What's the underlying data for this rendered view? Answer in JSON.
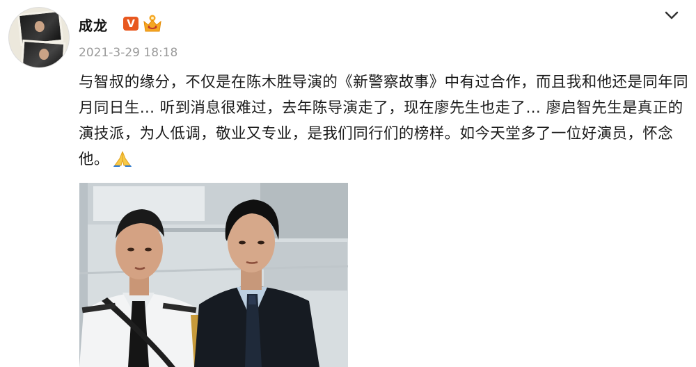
{
  "post": {
    "username": "成龙",
    "verified_badge": "V",
    "timestamp": "2021-3-29 18:18",
    "text": "与智叔的缘分，不仅是在陈木胜导演的《新警察故事》中有过合作，而且我和他还是同年同月同日生… 听到消息很难过，去年陈导演走了，现在廖先生也走了… 廖启智先生是真正的演技派，为人低调，敬业又专业，是我们同行们的榜样。如今天堂多了一位好演员，怀念他。",
    "emoji": "pray-emoji"
  },
  "icons": {
    "verified": "verified-v-icon",
    "membership": "crown-icon",
    "more": "chevron-down-icon"
  },
  "colors": {
    "verified_badge": "#e8581f",
    "timestamp": "#9a9a9a",
    "text": "#1a1a1a"
  }
}
